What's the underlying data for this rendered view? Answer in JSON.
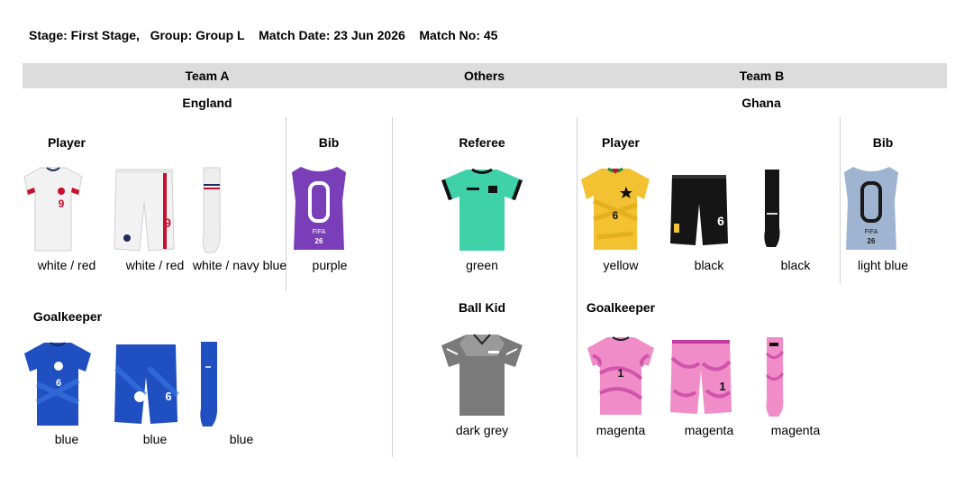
{
  "match": {
    "stage": "Stage: First Stage,",
    "group": "Group: Group L",
    "date": "Match Date: 23 Jun 2026",
    "number": "Match No: 45"
  },
  "header": {
    "team_a": "Team A",
    "others": "Others",
    "team_b": "Team B"
  },
  "team_a": {
    "name": "England",
    "player_heading": "Player",
    "bib_heading": "Bib",
    "goalkeeper_heading": "Goalkeeper",
    "player": {
      "shirt": "white / red",
      "shorts": "white / red",
      "socks": "white / navy blue"
    },
    "bib": "purple",
    "goalkeeper": {
      "shirt": "blue",
      "shorts": "blue",
      "socks": "blue"
    }
  },
  "others": {
    "referee_heading": "Referee",
    "referee": "green",
    "ballkid_heading": "Ball Kid",
    "ballkid": "dark grey"
  },
  "team_b": {
    "name": "Ghana",
    "player_heading": "Player",
    "bib_heading": "Bib",
    "goalkeeper_heading": "Goalkeeper",
    "player": {
      "shirt": "yellow",
      "shorts": "black",
      "socks": "black"
    },
    "bib": "light blue",
    "goalkeeper": {
      "shirt": "magenta",
      "shorts": "magenta",
      "socks": "magenta"
    }
  },
  "kit_numbers": {
    "eng_player": "9",
    "eng_gk": "6",
    "gha_player": "6",
    "gha_gk": "1",
    "bib_badge": "26"
  },
  "colors": {
    "eng_shirt": "#f2f2f2",
    "eng_trim": "#c8102e",
    "eng_navy": "#1d2a5c",
    "eng_gk": "#1f4fc0",
    "bib_purple": "#7a3fb8",
    "ref_green": "#3fd1a8",
    "ball_kid_grey": "#7a7a7a",
    "gha_yellow": "#f2c232",
    "gha_black": "#151515",
    "bib_light_blue": "#9fb4d0",
    "gha_gk": "#f08cc8"
  }
}
